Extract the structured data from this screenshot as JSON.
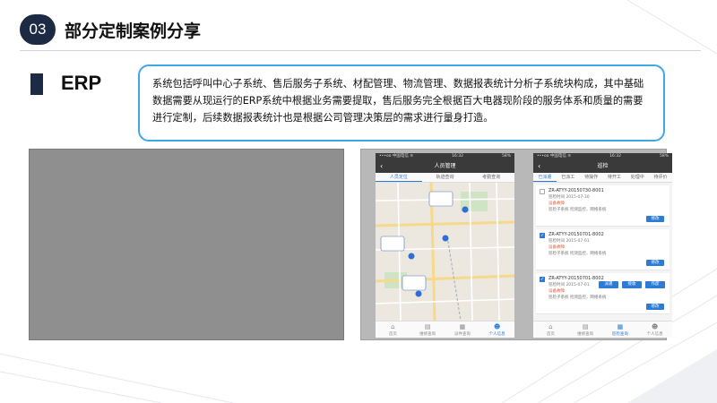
{
  "header": {
    "section_number": "03",
    "section_title": "部分定制案例分享"
  },
  "erp": {
    "label": "ERP",
    "description": "系统包括呼叫中心子系统、售后服务子系统、材配管理、物流管理、数据报表统计分析子系统块构成，其中基础数据需要从现运行的ERP系统中根据业务需要提取，售后服务完全根据百大电器现阶段的服务体系和质量的需要进行定制，后续数据报表统计也是根据公司管理决策层的需求进行量身打造。"
  },
  "phone_left": {
    "status_carrier": "•••oo 中国电信 ≋",
    "status_time": "16:32",
    "status_battery": "58%",
    "title": "人员管理",
    "back": "‹",
    "tabs": [
      "人员定位",
      "轨迹查询",
      "考勤查询"
    ],
    "nav": [
      {
        "icon": "⌂",
        "label": "首页"
      },
      {
        "icon": "▤",
        "label": "维修查询"
      },
      {
        "icon": "▦",
        "label": "派件查询"
      },
      {
        "icon": "☻",
        "label": "个人信息"
      }
    ]
  },
  "phone_right": {
    "status_carrier": "•••oo 中国电信 ≋",
    "status_time": "16:32",
    "status_battery": "58%",
    "title": "巡检",
    "back": "‹",
    "tabs": [
      "已派遣",
      "已派工",
      "待操作",
      "待开工",
      "处理中",
      "待评价"
    ],
    "orders": [
      {
        "no": "ZR-ATYY-20150730-8001",
        "time_label": "巡检时间",
        "time": "2015-07-30",
        "status": "设备故障",
        "desc": "巡检子系统",
        "note": "检测监控，网络系统",
        "checked": false,
        "button": "修改"
      },
      {
        "no": "ZR-ATYY-20150701-8002",
        "time_label": "巡检时间",
        "time": "2015-07-01",
        "status": "设备故障",
        "desc": "巡检子系统",
        "note": "检测监控，网络系统",
        "checked": true,
        "button": "修改"
      },
      {
        "no": "ZR-ATYY-20150701-8002",
        "time_label": "巡检时间",
        "time": "2015-07-01",
        "status": "设备故障",
        "desc": "巡检子系统",
        "note": "检测监控，网络系统",
        "checked": true,
        "button": "修改"
      }
    ],
    "actions": [
      "派遣",
      "接收",
      "作废"
    ],
    "nav": [
      {
        "icon": "⌂",
        "label": "首页"
      },
      {
        "icon": "▤",
        "label": "维修查询"
      },
      {
        "icon": "▦",
        "label": "巡检查询"
      },
      {
        "icon": "☻",
        "label": "个人信息"
      }
    ]
  },
  "colors": {
    "accent": "#3ea8e6",
    "dark": "#1c2a44",
    "app_blue": "#2e7bd6"
  }
}
